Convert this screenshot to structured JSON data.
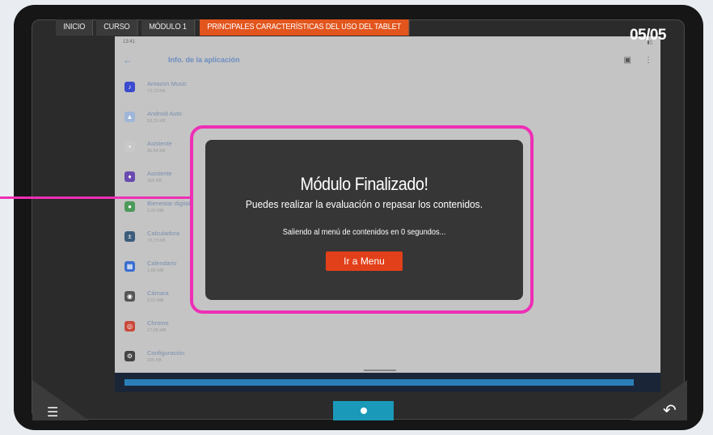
{
  "breadcrumb": [
    "INICIO",
    "CURSO",
    "MÓDULO 1",
    "PRINCIPALES CARACTERÍSTICAS DEL USO DEL TABLET"
  ],
  "page_counter": "05/05",
  "device": {
    "status_time": "13:41",
    "appbar_title": "Info. de la aplicación",
    "apps": [
      {
        "name": "Amazon Music",
        "size": "73,73 KB",
        "color": "#3b4bd0",
        "icon": "♪"
      },
      {
        "name": "Android Auto",
        "size": "53,25 KB",
        "color": "#9fb6d8",
        "icon": "▲"
      },
      {
        "name": "Asistente",
        "size": "36,84 KB",
        "color": "#c8c8c8",
        "icon": "•"
      },
      {
        "name": "Asistente",
        "size": "250 KB",
        "color": "#6a4ab0",
        "icon": "♦"
      },
      {
        "name": "Bienestar digital",
        "size": "2,20 MB",
        "color": "#4d9a5a",
        "icon": "●"
      },
      {
        "name": "Calculadora",
        "size": "73,73 KB",
        "color": "#3b5c7a",
        "icon": "±"
      },
      {
        "name": "Calendario",
        "size": "1,66 MB",
        "color": "#3b6fd0",
        "icon": "▦"
      },
      {
        "name": "Cámara",
        "size": "5,61 MB",
        "color": "#555",
        "icon": "◉"
      },
      {
        "name": "Chrome",
        "size": "17,06 MB",
        "color": "#c94a3a",
        "icon": "◎"
      },
      {
        "name": "Configuración",
        "size": "225 KB",
        "color": "#444",
        "icon": "⚙"
      }
    ]
  },
  "dialog": {
    "title": "Módulo Finalizado!",
    "subtitle": "Puedes realizar la evaluación o repasar los contenidos.",
    "exit_message": "Saliendo al menú de contenidos en  0  segundos...",
    "button": "Ir a Menu"
  },
  "colors": {
    "accent": "#e2551d",
    "highlight": "#ee2fb5",
    "nav": "#1a9ab8"
  }
}
